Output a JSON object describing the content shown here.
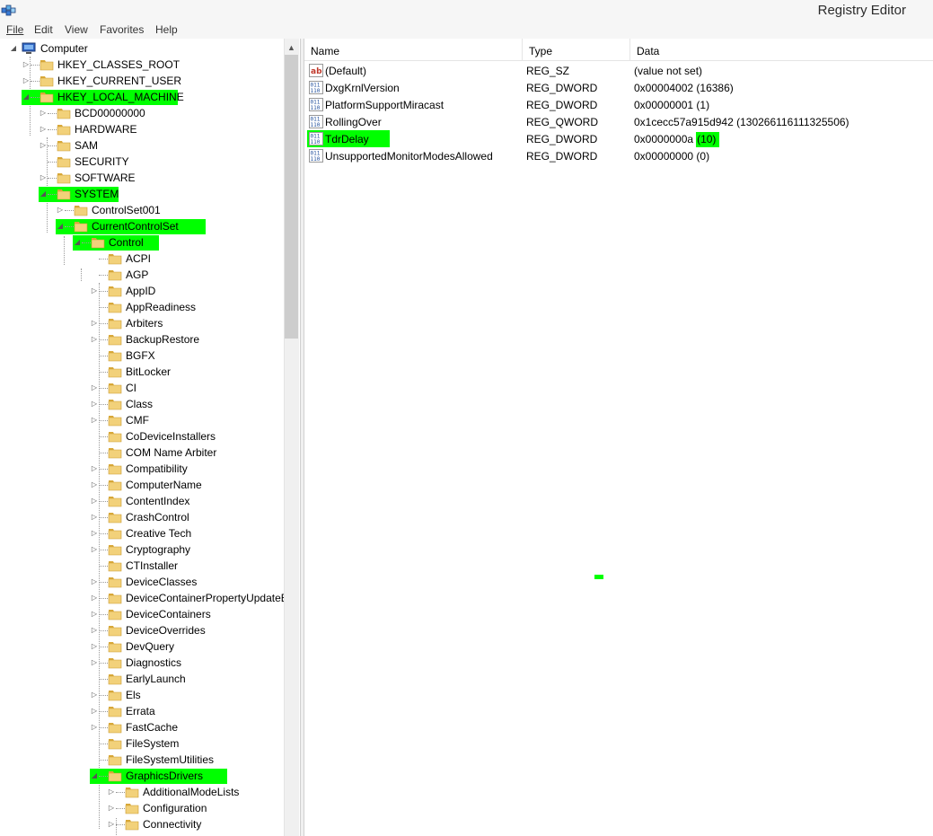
{
  "window": {
    "title": "Registry Editor"
  },
  "menu": [
    {
      "u": "F",
      "rest": "ile"
    },
    {
      "u": "E",
      "rest": "dit"
    },
    {
      "u": "V",
      "rest": "iew"
    },
    {
      "u": "",
      "rest": "Favorites",
      "u_mid": "a"
    },
    {
      "u": "H",
      "rest": "elp"
    }
  ],
  "menu_labels": [
    "File",
    "Edit",
    "View",
    "Favorites",
    "Help"
  ],
  "tree": {
    "root": "Computer",
    "nodes": [
      {
        "label": "HKEY_CLASSES_ROOT",
        "level": 1,
        "expander": "closed",
        "highlight": false
      },
      {
        "label": "HKEY_CURRENT_USER",
        "level": 1,
        "expander": "closed",
        "highlight": false
      },
      {
        "label": "HKEY_LOCAL_MACHINE",
        "level": 1,
        "expander": "open",
        "highlight": true
      },
      {
        "label": "BCD00000000",
        "level": 2,
        "expander": "closed",
        "highlight": false
      },
      {
        "label": "HARDWARE",
        "level": 2,
        "expander": "closed",
        "highlight": false
      },
      {
        "label": "SAM",
        "level": 2,
        "expander": "closed",
        "highlight": false
      },
      {
        "label": "SECURITY",
        "level": 2,
        "expander": "none",
        "highlight": false
      },
      {
        "label": "SOFTWARE",
        "level": 2,
        "expander": "closed",
        "highlight": false
      },
      {
        "label": "SYSTEM",
        "level": 2,
        "expander": "open",
        "highlight": true
      },
      {
        "label": "ControlSet001",
        "level": 3,
        "expander": "closed",
        "highlight": false
      },
      {
        "label": "CurrentControlSet",
        "level": 3,
        "expander": "open",
        "highlight": true
      },
      {
        "label": "Control",
        "level": 4,
        "expander": "open",
        "highlight": true
      },
      {
        "label": "ACPI",
        "level": 5,
        "expander": "none",
        "highlight": false
      },
      {
        "label": "AGP",
        "level": 5,
        "expander": "none",
        "highlight": false
      },
      {
        "label": "AppID",
        "level": 5,
        "expander": "closed",
        "highlight": false
      },
      {
        "label": "AppReadiness",
        "level": 5,
        "expander": "none",
        "highlight": false
      },
      {
        "label": "Arbiters",
        "level": 5,
        "expander": "closed",
        "highlight": false
      },
      {
        "label": "BackupRestore",
        "level": 5,
        "expander": "closed",
        "highlight": false
      },
      {
        "label": "BGFX",
        "level": 5,
        "expander": "none",
        "highlight": false
      },
      {
        "label": "BitLocker",
        "level": 5,
        "expander": "none",
        "highlight": false
      },
      {
        "label": "CI",
        "level": 5,
        "expander": "closed",
        "highlight": false
      },
      {
        "label": "Class",
        "level": 5,
        "expander": "closed",
        "highlight": false
      },
      {
        "label": "CMF",
        "level": 5,
        "expander": "closed",
        "highlight": false
      },
      {
        "label": "CoDeviceInstallers",
        "level": 5,
        "expander": "none",
        "highlight": false
      },
      {
        "label": "COM Name Arbiter",
        "level": 5,
        "expander": "none",
        "highlight": false
      },
      {
        "label": "Compatibility",
        "level": 5,
        "expander": "closed",
        "highlight": false
      },
      {
        "label": "ComputerName",
        "level": 5,
        "expander": "closed",
        "highlight": false
      },
      {
        "label": "ContentIndex",
        "level": 5,
        "expander": "closed",
        "highlight": false
      },
      {
        "label": "CrashControl",
        "level": 5,
        "expander": "closed",
        "highlight": false
      },
      {
        "label": "Creative Tech",
        "level": 5,
        "expander": "closed",
        "highlight": false
      },
      {
        "label": "Cryptography",
        "level": 5,
        "expander": "closed",
        "highlight": false
      },
      {
        "label": "CTInstaller",
        "level": 5,
        "expander": "none",
        "highlight": false
      },
      {
        "label": "DeviceClasses",
        "level": 5,
        "expander": "closed",
        "highlight": false
      },
      {
        "label": "DeviceContainerPropertyUpdateE",
        "level": 5,
        "expander": "closed",
        "highlight": false
      },
      {
        "label": "DeviceContainers",
        "level": 5,
        "expander": "closed",
        "highlight": false
      },
      {
        "label": "DeviceOverrides",
        "level": 5,
        "expander": "closed",
        "highlight": false
      },
      {
        "label": "DevQuery",
        "level": 5,
        "expander": "closed",
        "highlight": false
      },
      {
        "label": "Diagnostics",
        "level": 5,
        "expander": "closed",
        "highlight": false
      },
      {
        "label": "EarlyLaunch",
        "level": 5,
        "expander": "none",
        "highlight": false
      },
      {
        "label": "Els",
        "level": 5,
        "expander": "closed",
        "highlight": false
      },
      {
        "label": "Errata",
        "level": 5,
        "expander": "closed",
        "highlight": false
      },
      {
        "label": "FastCache",
        "level": 5,
        "expander": "closed",
        "highlight": false
      },
      {
        "label": "FileSystem",
        "level": 5,
        "expander": "none",
        "highlight": false
      },
      {
        "label": "FileSystemUtilities",
        "level": 5,
        "expander": "none",
        "highlight": false
      },
      {
        "label": "GraphicsDrivers",
        "level": 5,
        "expander": "open",
        "highlight": true
      },
      {
        "label": "AdditionalModeLists",
        "level": 6,
        "expander": "closed",
        "highlight": false
      },
      {
        "label": "Configuration",
        "level": 6,
        "expander": "closed",
        "highlight": false
      },
      {
        "label": "Connectivity",
        "level": 6,
        "expander": "closed",
        "highlight": false
      }
    ]
  },
  "list": {
    "columns": [
      "Name",
      "Type",
      "Data"
    ],
    "rows": [
      {
        "icon": "string-value-icon",
        "name": "(Default)",
        "type": "REG_SZ",
        "data": "(value not set)",
        "highlight_name": false,
        "data_main": "(value not set)",
        "data_hl": ""
      },
      {
        "icon": "binary-value-icon",
        "name": "DxgKrnlVersion",
        "type": "REG_DWORD",
        "data": "0x00004002 (16386)",
        "highlight_name": false,
        "data_main": "0x00004002 (16386)",
        "data_hl": ""
      },
      {
        "icon": "binary-value-icon",
        "name": "PlatformSupportMiracast",
        "type": "REG_DWORD",
        "data": "0x00000001 (1)",
        "highlight_name": false,
        "data_main": "0x00000001 (1)",
        "data_hl": ""
      },
      {
        "icon": "binary-value-icon",
        "name": "RollingOver",
        "type": "REG_QWORD",
        "data": "0x1cecc57a915d942 (130266116111325506)",
        "highlight_name": false,
        "data_main": "0x1cecc57a915d942 (130266116111325506)",
        "data_hl": ""
      },
      {
        "icon": "binary-value-icon",
        "name": "TdrDelay",
        "type": "REG_DWORD",
        "data": "0x0000000a (10)",
        "highlight_name": true,
        "data_main": "0x0000000a",
        "data_hl": "(10)"
      },
      {
        "icon": "binary-value-icon",
        "name": "UnsupportedMonitorModesAllowed",
        "type": "REG_DWORD",
        "data": "0x00000000 (0)",
        "highlight_name": false,
        "data_main": "0x00000000 (0)",
        "data_hl": ""
      }
    ]
  },
  "colors": {
    "highlight": "#00ff00",
    "folder": "#e8c25a"
  }
}
